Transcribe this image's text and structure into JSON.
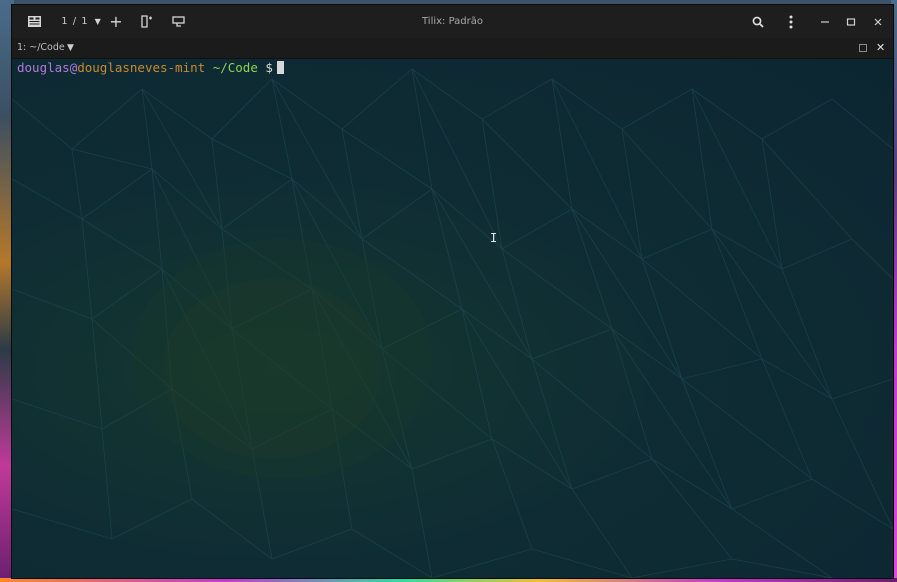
{
  "window": {
    "title": "Tilix: Padrão",
    "session_label": "1 / 1",
    "colors": {
      "titlebar": "#1e1e1e",
      "terminal_bg": "#0f2a33",
      "user": "#b07ad8",
      "host": "#c98a2e",
      "path": "#8fd14f"
    }
  },
  "toolbar": {
    "menu_icon": "terminal-menu-icon",
    "session_dropdown_icon": "chevron-down-icon",
    "add_icon": "plus-icon",
    "split_icon": "new-terminal-icon",
    "sync_icon": "sync-input-icon",
    "search_icon": "search-icon",
    "more_icon": "kebab-menu-icon",
    "minimize_icon": "minimize-icon",
    "maximize_icon": "maximize-icon",
    "close_icon": "close-icon"
  },
  "tab": {
    "title": "1: ~/Code",
    "caret_icon": "chevron-down-icon",
    "maximize_icon": "maximize-terminal-icon",
    "close_icon": "close-terminal-icon"
  },
  "prompt": {
    "user": "douglas",
    "at": "@",
    "host": "douglasneves-mint",
    "path": "~/Code",
    "symbol": "$"
  }
}
